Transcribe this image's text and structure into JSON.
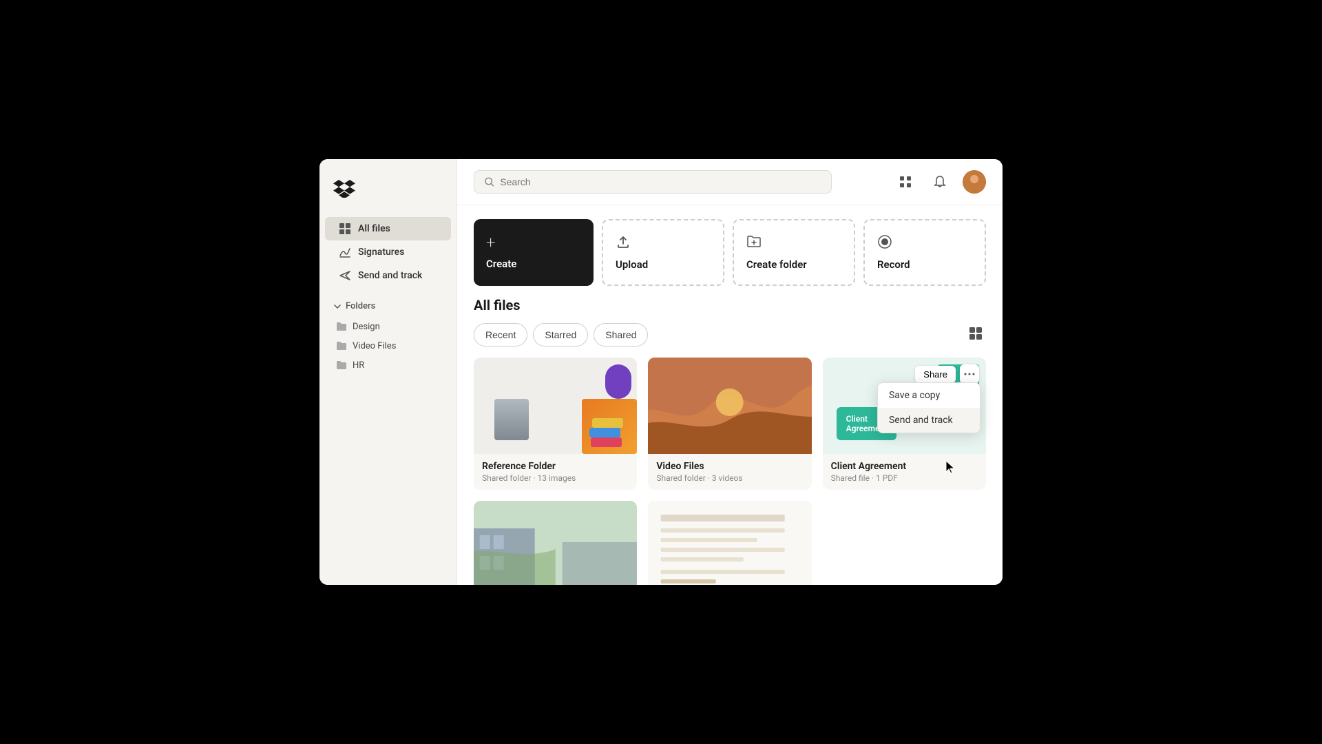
{
  "sidebar": {
    "logo_alt": "Dropbox logo",
    "nav": [
      {
        "id": "all-files",
        "label": "All files",
        "active": true
      },
      {
        "id": "signatures",
        "label": "Signatures",
        "active": false
      },
      {
        "id": "send-and-track",
        "label": "Send and track",
        "active": false
      }
    ],
    "folders_header": "Folders",
    "folders": [
      {
        "id": "design",
        "label": "Design"
      },
      {
        "id": "video-files",
        "label": "Video Files"
      },
      {
        "id": "hr",
        "label": "HR"
      }
    ]
  },
  "header": {
    "search_placeholder": "Search"
  },
  "action_cards": [
    {
      "id": "create",
      "label": "Create",
      "icon": "+"
    },
    {
      "id": "upload",
      "label": "Upload",
      "icon": "↑"
    },
    {
      "id": "create-folder",
      "label": "Create folder",
      "icon": "📁"
    },
    {
      "id": "record",
      "label": "Record",
      "icon": "⏺"
    }
  ],
  "files_section": {
    "title": "All files",
    "filters": [
      {
        "id": "recent",
        "label": "Recent",
        "active": false
      },
      {
        "id": "starred",
        "label": "Starred",
        "active": false
      },
      {
        "id": "shared",
        "label": "Shared",
        "active": false
      }
    ],
    "files": [
      {
        "id": "reference-folder",
        "name": "Reference Folder",
        "meta": "Shared folder · 13 images",
        "type": "folder-collage"
      },
      {
        "id": "video-files",
        "name": "Video Files",
        "meta": "Shared folder · 3 videos",
        "type": "video"
      },
      {
        "id": "client-agreement",
        "name": "Client Agreement",
        "meta": "Shared file · 1 PDF",
        "type": "client",
        "has_context_menu": true
      }
    ]
  },
  "context_menu": {
    "share_label": "Share",
    "more_label": "⋯",
    "items": [
      {
        "id": "save-copy",
        "label": "Save a copy"
      },
      {
        "id": "send-track",
        "label": "Send and track"
      }
    ]
  },
  "colors": {
    "create_bg": "#1a1a1a",
    "accent_teal": "#2db89a",
    "sidebar_active": "#e0ddd6"
  }
}
